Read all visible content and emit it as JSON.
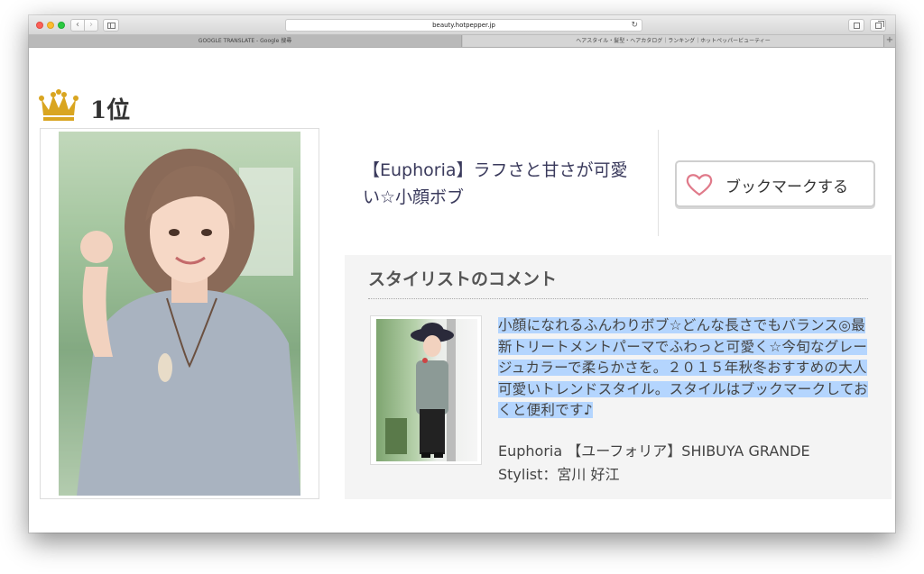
{
  "browser": {
    "url": "beauty.hotpepper.jp",
    "tabs": [
      {
        "label": "GOOGLE TRANSLATE - Google 搜尋"
      },
      {
        "label": "ヘアスタイル・髪型・ヘアカタログ｜ランキング｜ホットペッパービューティー"
      }
    ],
    "back_glyph": "‹",
    "forward_glyph": "›",
    "reload_glyph": "↻",
    "new_tab_glyph": "+"
  },
  "ranking": {
    "rank_label": "1位"
  },
  "style": {
    "title": "【Euphoria】ラフさと甘さが可愛い☆小顔ボブ",
    "bookmark_label": "ブックマークする"
  },
  "comment": {
    "heading": "スタイリストのコメント",
    "text": "小顔になれるふんわりボブ☆どんな長さでもバランス◎最新トリートメントパーマでふわっと可愛く☆今旬なグレージュカラーで柔らかさを。２０１５年秋冬おすすめの大人可愛いトレンドスタイル。スタイルはブックマークしておくと便利です♪",
    "salon": "Euphoria 【ユーフォリア】SHIBUYA GRANDE",
    "stylist": "Stylist：宮川 好江"
  },
  "colors": {
    "crown": "#d9a520",
    "heart": "#e07a8a",
    "selection": "#b4d5fe",
    "title_text": "#3a3a5c"
  }
}
